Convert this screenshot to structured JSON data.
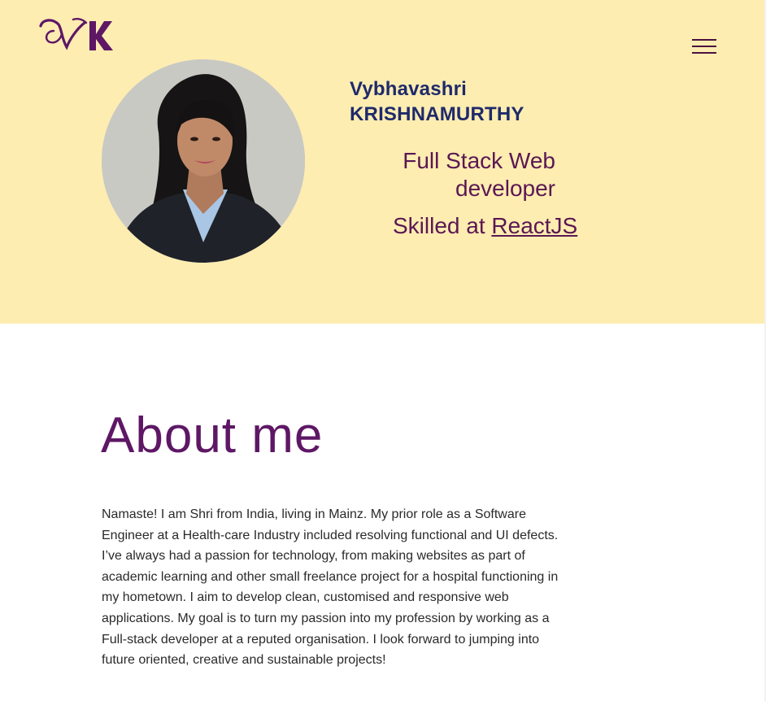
{
  "header": {
    "logo_text": "VK",
    "menu_icon": "hamburger-menu-icon"
  },
  "hero": {
    "first_name": "Vybhavashri",
    "last_name": "KRISHNAMURTHY",
    "role": "Full Stack Web developer",
    "skill_prefix": "Skilled at ",
    "skill": "ReactJS"
  },
  "about": {
    "title": "About me",
    "text": "Namaste! I am Shri from India, living in Mainz. My prior role as a Software Engineer at a Health-care Industry included resolving functional and UI defects. I’ve always had a passion for technology, from making websites as part of academic learning and other small freelance project for a hospital functioning in my hometown. I aim to develop clean, customised and responsive web applications. My goal is to turn my passion into my profession by working as a Full-stack developer at a reputed organisation. I look forward to jumping into future oriented, creative and sustainable projects!"
  },
  "colors": {
    "hero_background": "#fdedb1",
    "brand_purple": "#5e1765",
    "name_navy": "#1f2a6b"
  }
}
